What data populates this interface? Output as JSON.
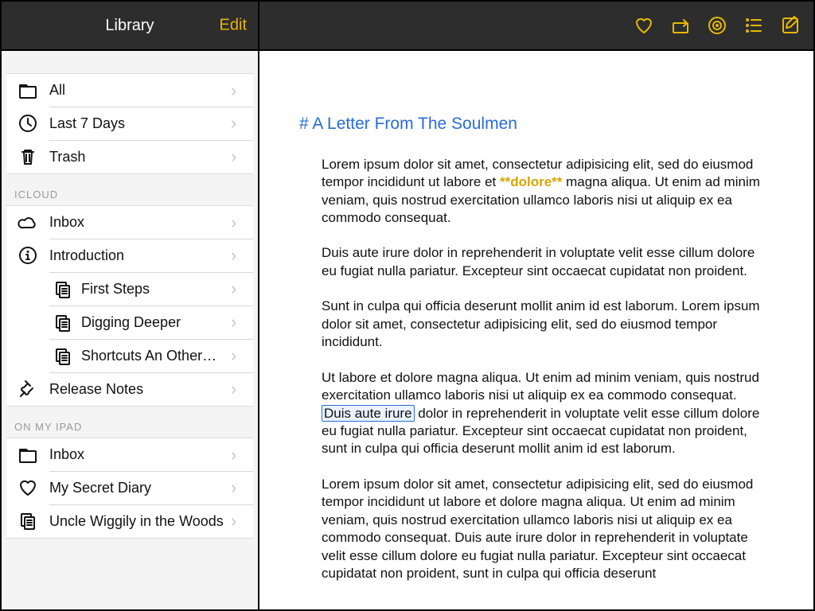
{
  "sidebar": {
    "title": "Library",
    "edit_label": "Edit",
    "top": [
      {
        "icon": "folder",
        "label": "All"
      },
      {
        "icon": "clock",
        "label": "Last 7 Days"
      },
      {
        "icon": "trash",
        "label": "Trash"
      }
    ],
    "sections": [
      {
        "header": "ICLOUD",
        "items": [
          {
            "icon": "cloud",
            "label": "Inbox"
          },
          {
            "icon": "info",
            "label": "Introduction",
            "expanded": true,
            "children": [
              {
                "icon": "pages",
                "label": "First Steps"
              },
              {
                "icon": "pages",
                "label": "Digging Deeper"
              },
              {
                "icon": "pages",
                "label": "Shortcuts An Other…"
              }
            ]
          },
          {
            "icon": "pin",
            "label": "Release Notes"
          }
        ]
      },
      {
        "header": "ON MY IPAD",
        "items": [
          {
            "icon": "folder",
            "label": "Inbox"
          },
          {
            "icon": "heart",
            "label": "My Secret Diary"
          },
          {
            "icon": "pages",
            "label": "Uncle Wiggily in the Woods"
          }
        ]
      }
    ]
  },
  "toolbar": {
    "icons": [
      "heart",
      "share",
      "target",
      "checklist",
      "compose"
    ]
  },
  "document": {
    "heading": "# A Letter From The Soulmen",
    "p1a": "Lorem ipsum dolor sit amet, consectetur adipisicing elit, sed do eiusmod tempor incididunt ut labore et ",
    "p1_bold": "**dolore**",
    "p1b": " magna aliqua. Ut enim ad minim veniam, quis nostrud exercitation ullamco laboris nisi ut aliquip ex ea commodo consequat.",
    "p2": "Duis aute irure dolor in reprehenderit in voluptate velit esse cillum dolore eu fugiat nulla pariatur. Excepteur sint occaecat cupidatat non proident.",
    "p3": "Sunt in culpa qui officia deserunt mollit anim id est laborum. Lorem ipsum dolor sit amet, consectetur adipisicing elit, sed do eiusmod tempor incididunt.",
    "p4a": "Ut labore et dolore magna aliqua. Ut enim ad minim veniam, quis nostrud exercitation ullamco laboris nisi ut aliquip ex ea commodo consequat. ",
    "p4_sel": "Duis aute irure",
    "p4b": " dolor in reprehenderit in voluptate velit esse cillum dolore eu fugiat nulla pariatur. Excepteur sint occaecat cupidatat non proident, sunt in culpa qui officia deserunt mollit anim id est laborum.",
    "p5": "Lorem ipsum dolor sit amet, consectetur adipisicing elit, sed do eiusmod tempor incididunt ut labore et dolore magna aliqua. Ut enim ad minim veniam, quis nostrud exercitation ullamco laboris nisi ut aliquip ex ea commodo consequat. Duis aute irure dolor in reprehenderit in voluptate velit esse cillum dolore eu fugiat nulla pariatur. Excepteur sint occaecat cupidatat non proident, sunt in culpa qui officia deserunt"
  }
}
